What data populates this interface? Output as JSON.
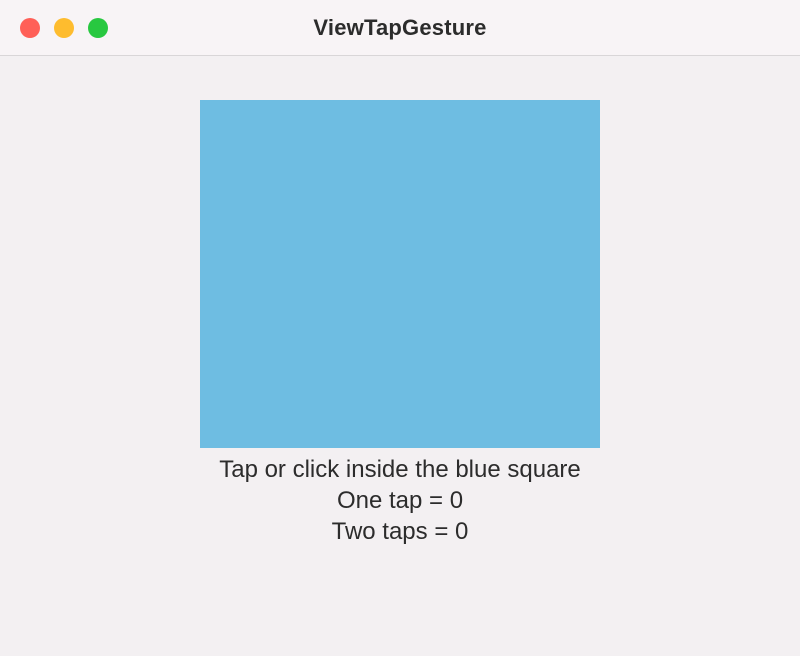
{
  "window": {
    "title": "ViewTapGesture"
  },
  "colors": {
    "square": "#6ebde2"
  },
  "instruction": "Tap or click inside the blue square",
  "counters": {
    "oneTapPrefix": "One tap = ",
    "oneTapValue": "0",
    "twoTapsPrefix": "Two taps = ",
    "twoTapsValue": "0"
  }
}
